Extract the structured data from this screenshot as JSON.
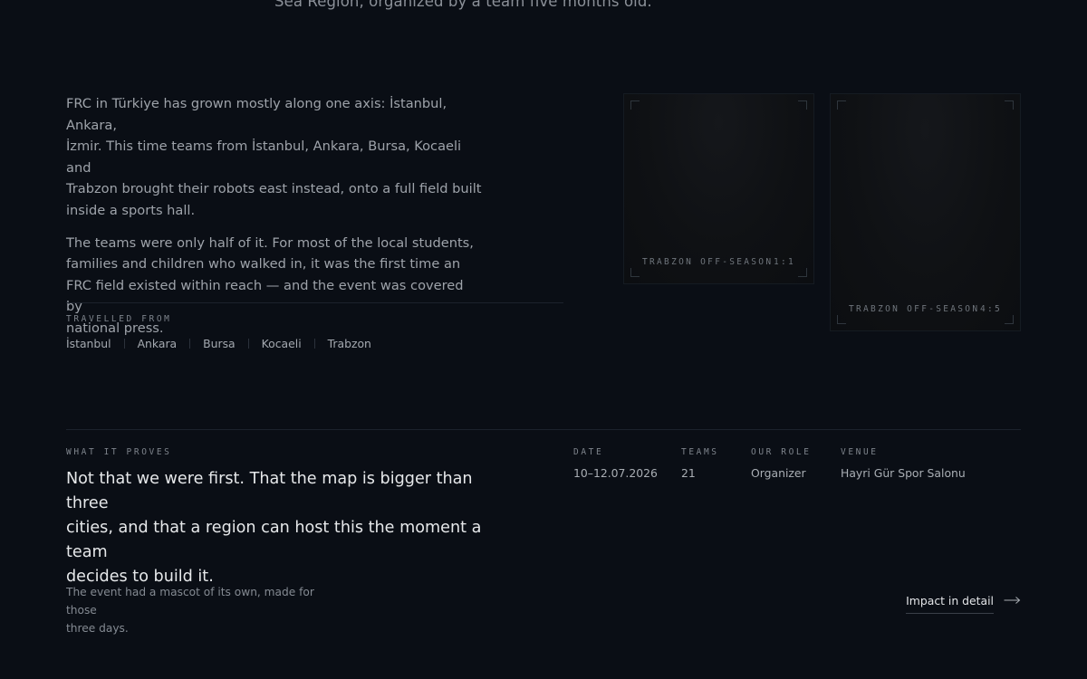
{
  "intro": {
    "lead_tail": "Sea Region, organized by a team five months old."
  },
  "story": {
    "paragraphs": [
      "FRC in Türkiye has grown mostly along one axis: İstanbul, Ankara,\nİzmir. This time teams from İstanbul, Ankara, Bursa, Kocaeli and\nTrabzon brought their robots east instead, onto a full field built\ninside a sports hall.",
      "The teams were only half of it. For most of the local students,\nfamilies and children who walked in, it was the first time an\nFRC field existed within reach — and the event was covered by\nnational press."
    ]
  },
  "travelled": {
    "label": "TRAVELLED FROM",
    "cities": [
      "İstanbul",
      "Ankara",
      "Bursa",
      "Kocaeli",
      "Trabzon"
    ]
  },
  "media": [
    {
      "title": "TRABZON OFF-SEASON",
      "ratio": "1:1"
    },
    {
      "title": "TRABZON OFF-SEASON",
      "ratio": "4:5"
    }
  ],
  "proves": {
    "label": "WHAT IT PROVES",
    "quote": "Not that we were first. That the map is bigger than three\ncities, and that a region can host this the moment a team\ndecides to build it."
  },
  "meta": {
    "date": {
      "label": "DATE",
      "value": "10–12.07.2026"
    },
    "teams": {
      "label": "TEAMS",
      "value": "21"
    },
    "role": {
      "label": "OUR ROLE",
      "value": "Organizer"
    },
    "venue": {
      "label": "VENUE",
      "value": "Hayri Gür Spor Salonu"
    }
  },
  "footnote": "The event had a mascot of its own, made for those\nthree days.",
  "impact_link": {
    "label": "Impact in detail",
    "icon": "arrow-right-icon"
  },
  "colors": {
    "background": "#0a0e15",
    "heading": "#e6e8ea",
    "body": "#9ea3aa",
    "muted": "#7e848c",
    "rule": "#1c222c"
  }
}
